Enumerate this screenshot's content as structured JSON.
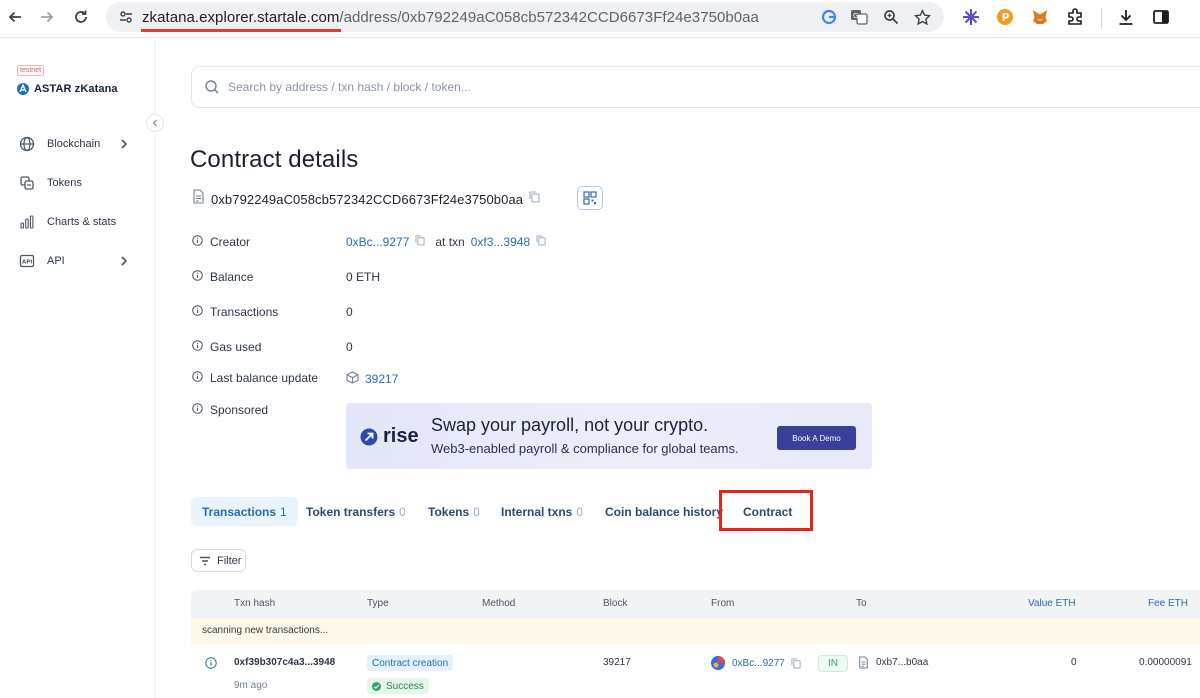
{
  "browser": {
    "url_host": "zkatana.explorer.startale.com",
    "url_path": "/address/0xb792249aC058cb572342CCD6673Ff24e3750b0aa"
  },
  "sidebar": {
    "badge": "testnet",
    "brand": "ASTAR zKatana",
    "items": [
      {
        "label": "Blockchain"
      },
      {
        "label": "Tokens"
      },
      {
        "label": "Charts & stats"
      },
      {
        "label": "API"
      }
    ]
  },
  "search": {
    "placeholder": "Search by address / txn hash / block / token..."
  },
  "page": {
    "title": "Contract details",
    "address": "0xb792249aC058cb572342CCD6673Ff24e3750b0aa"
  },
  "details": {
    "creator_label": "Creator",
    "creator_value": "0xBc...9277",
    "creator_at_txn": "at txn",
    "creator_txn": "0xf3...3948",
    "balance_label": "Balance",
    "balance_value": "0 ETH",
    "transactions_label": "Transactions",
    "transactions_value": "0",
    "gas_label": "Gas used",
    "gas_value": "0",
    "last_update_label": "Last balance update",
    "last_update_value": "39217",
    "sponsored_label": "Sponsored"
  },
  "ad": {
    "brand": "rise",
    "headline": "Swap your payroll, not your crypto.",
    "subline": "Web3-enabled payroll & compliance for global teams.",
    "cta": "Book A Demo"
  },
  "tabs": [
    {
      "label": "Transactions",
      "count": "1"
    },
    {
      "label": "Token transfers",
      "count": "0"
    },
    {
      "label": "Tokens",
      "count": "0"
    },
    {
      "label": "Internal txns",
      "count": "0"
    },
    {
      "label": "Coin balance history",
      "count": ""
    },
    {
      "label": "Contract",
      "count": ""
    }
  ],
  "filter": {
    "label": "Filter"
  },
  "table": {
    "headers": [
      "Txn hash",
      "Type",
      "Method",
      "Block",
      "From",
      "To",
      "Value ETH",
      "Fee ETH"
    ],
    "scanning": "scanning new transactions...",
    "row": {
      "hash": "0xf39b307c4a3...3948",
      "age": "9m ago",
      "type": "Contract creation",
      "status": "Success",
      "block": "39217",
      "from": "0xBc...9277",
      "direction": "IN",
      "to": "0xb7...b0aa",
      "value": "0",
      "fee": "0.00000091"
    }
  },
  "colors": {
    "accent": "#2b6cb0",
    "highlight": "#e5251c",
    "ad_cta": "#3b3f9c"
  }
}
